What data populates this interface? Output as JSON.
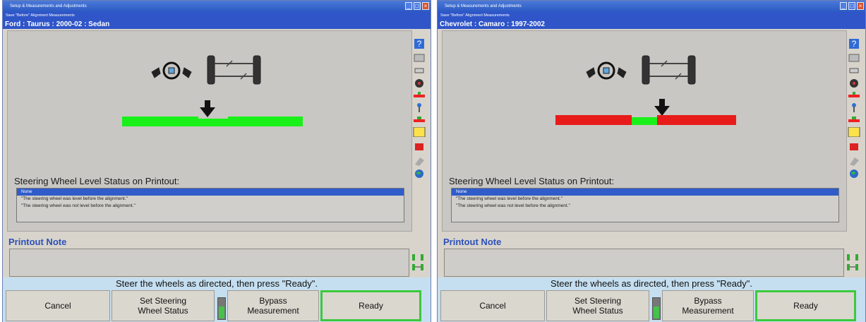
{
  "windows": [
    {
      "title": "Setup & Measurements and Adjustments",
      "subtitle": "Save \"Before\" Alignment Measurements",
      "vehicle": "Ford : Taurus : 2000-02 : Sedan",
      "level_status_label": "Steering Wheel Level Status on Printout:",
      "options": [
        "None",
        "\"The steering wheel was level before the alignment.\"",
        "\"The steering wheel was not level before the alignment.\""
      ],
      "printout_note_label": "Printout Note",
      "message": "Steer the wheels as directed, then press \"Ready\".",
      "buttons": {
        "cancel": "Cancel",
        "set_steer_1": "Set Steering",
        "set_steer_2": "Wheel Status",
        "bypass_1": "Bypass",
        "bypass_2": "Measurement",
        "ready": "Ready"
      },
      "bar_state": "green",
      "bar_colors": {
        "left": "#19f019",
        "right": "#19f019",
        "center": "#19f019"
      }
    },
    {
      "title": "Setup & Measurements and Adjustments",
      "subtitle": "Save \"Before\" Alignment Measurements",
      "vehicle": "Chevrolet : Camaro : 1997-2002",
      "level_status_label": "Steering Wheel Level Status on Printout:",
      "options": [
        "None",
        "\"The steering wheel was level before the alignment.\"",
        "\"The steering wheel was not level before the alignment.\""
      ],
      "printout_note_label": "Printout Note",
      "message": "Steer the wheels as directed, then press \"Ready\".",
      "buttons": {
        "cancel": "Cancel",
        "set_steer_1": "Set Steering",
        "set_steer_2": "Wheel Status",
        "bypass_1": "Bypass",
        "bypass_2": "Measurement",
        "ready": "Ready"
      },
      "bar_state": "red",
      "bar_colors": {
        "left": "#e81b1b",
        "right": "#e81b1b",
        "center": "#19f019"
      }
    }
  ]
}
